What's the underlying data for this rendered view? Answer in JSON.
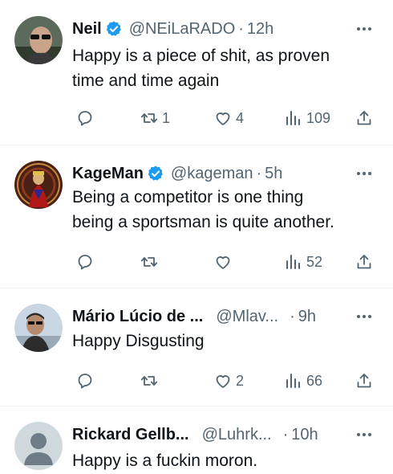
{
  "tweets": [
    {
      "name": "Neil",
      "handle": "@NEiLaRADO",
      "dot": "·",
      "time": "12h",
      "text": "Happy is a piece of shit, as proven\ntime and time again",
      "verified": true,
      "counts": {
        "reply": "",
        "retweet": "1",
        "like": "4",
        "views": "109"
      }
    },
    {
      "name": "KageMan",
      "handle": "@kageman",
      "dot": "·",
      "time": "5h",
      "text": "Being a competitor is one thing\nbeing a sportsman is quite another.",
      "verified": true,
      "counts": {
        "reply": "",
        "retweet": "",
        "like": "",
        "views": "52"
      }
    },
    {
      "name": "Mário Lúcio de ...",
      "handle": "@Mlav...",
      "dot": "·",
      "time": "9h",
      "text": "Happy Disgusting",
      "verified": false,
      "counts": {
        "reply": "",
        "retweet": "",
        "like": "2",
        "views": "66"
      }
    },
    {
      "name": "Rickard Gellb...",
      "handle": "@Luhrk...",
      "dot": "·",
      "time": "10h",
      "text": "Happy is a fuckin moron.",
      "verified": false
    }
  ],
  "colors": {
    "text": "#0f1419",
    "muted": "#536471",
    "verified": "#1d9bf0",
    "separator": "#eff3f4"
  },
  "icons": [
    "reply-icon",
    "retweet-icon",
    "like-icon",
    "views-icon",
    "share-icon",
    "more-icon",
    "verified-badge-icon"
  ]
}
